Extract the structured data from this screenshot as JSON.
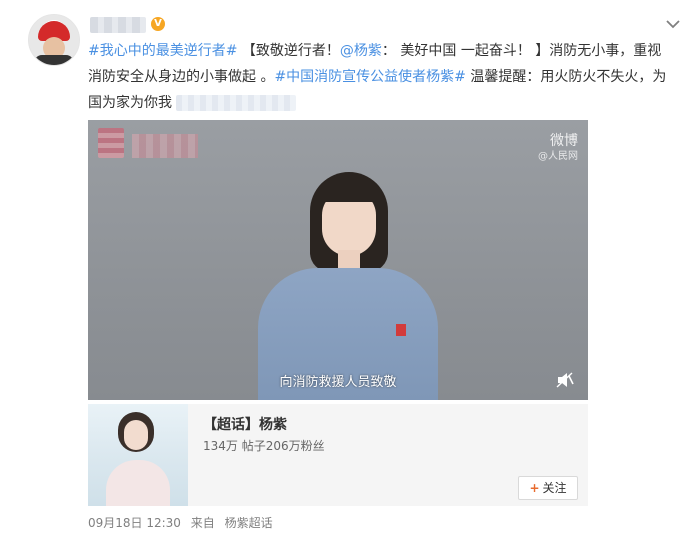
{
  "post": {
    "hashtag1": "#我心中的最美逆行者#",
    "text1": " 【致敬逆行者！",
    "mention": "@杨紫",
    "text2": "： 美好中国 一起奋斗！ 】消防无小事，重视消防安全从身边的小事做起 。",
    "hashtag2": "#中国消防宣传公益使者杨紫#",
    "text3": " 温馨提醒：用火防火不失火，为国为家为你我"
  },
  "verified_badge": "V",
  "video": {
    "weibo_watermark": "微博",
    "weibo_sub": "@人民网",
    "subtitle": "向消防救援人员致敬"
  },
  "card": {
    "title": "【超话】杨紫",
    "stats": "134万  帖子206万粉丝",
    "follow_label": "关注",
    "follow_plus": "+"
  },
  "meta": {
    "time": "09月18日 12:30",
    "source_prefix": "来自",
    "source": "杨紫超话"
  },
  "colors": {
    "link": "#4a90e2",
    "text": "#333333",
    "meta": "#808080",
    "accent": "#e86b2e"
  }
}
